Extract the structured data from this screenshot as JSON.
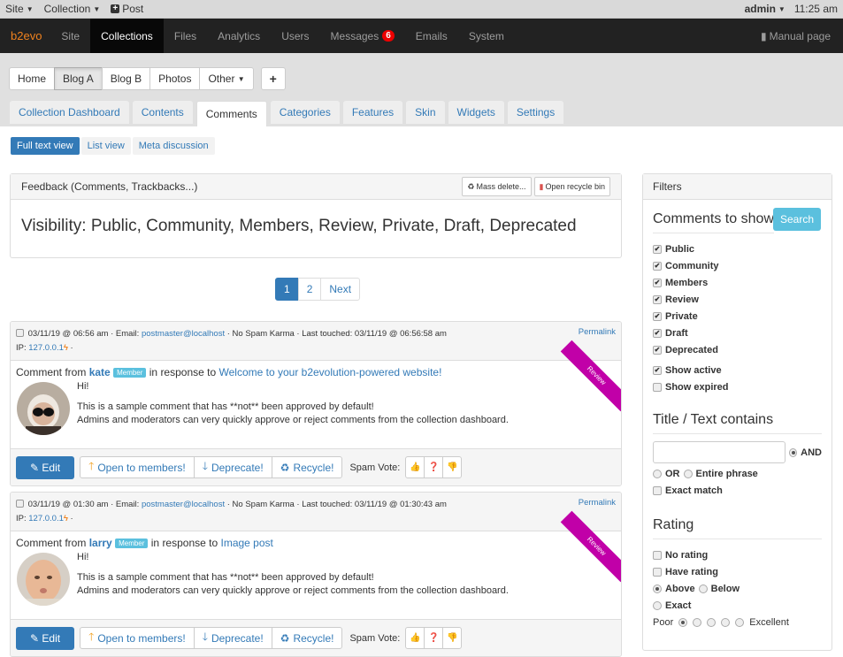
{
  "topbar": {
    "site": "Site",
    "collection": "Collection",
    "post": "Post",
    "user": "admin",
    "time": "11:25 am"
  },
  "nav": {
    "brand": "b2evo",
    "items": [
      "Site",
      "Collections",
      "Files",
      "Analytics",
      "Users",
      "Messages",
      "Emails",
      "System"
    ],
    "active": "Collections",
    "messages_badge": "6",
    "manual": "Manual page"
  },
  "collections": {
    "items": [
      "Home",
      "Blog A",
      "Blog B",
      "Photos",
      "Other"
    ],
    "selected": "Blog A",
    "add": "+"
  },
  "tabs": {
    "items": [
      "Collection Dashboard",
      "Contents",
      "Comments",
      "Categories",
      "Features",
      "Skin",
      "Widgets",
      "Settings"
    ],
    "active": "Comments"
  },
  "views": {
    "items": [
      "Full text view",
      "List view",
      "Meta discussion"
    ],
    "active": "Full text view"
  },
  "feedback": {
    "title": "Feedback (Comments, Trackbacks...)",
    "mass_delete": "Mass delete...",
    "recycle_bin": "Open recycle bin",
    "visibility": "Visibility: Public, Community, Members, Review, Private, Draft, Deprecated"
  },
  "pagination": {
    "pages": [
      "1",
      "2"
    ],
    "current": "1",
    "next": "Next"
  },
  "comments": [
    {
      "date": "03/11/19 @ 06:56 am",
      "email_label": "Email:",
      "email": "postmaster@localhost",
      "karma": "No Spam Karma",
      "touched": "Last touched: 03/11/19 @ 06:56:58 am",
      "ip_label": "IP:",
      "ip": "127.0.0.1",
      "permalink": "Permalink",
      "from_label": "Comment from",
      "author": "kate",
      "badge": "Member",
      "response_label": "in response to",
      "post": "Welcome to your b2evolution-powered website!",
      "status": "Review",
      "text": [
        "Hi!",
        "This is a sample comment that has **not** been approved by default!",
        "Admins and moderators can very quickly approve or reject comments from the collection dashboard."
      ],
      "edit": "Edit",
      "open": "Open to members!",
      "deprecate": "Deprecate!",
      "recycle": "Recycle!",
      "spam_vote": "Spam Vote:"
    },
    {
      "date": "03/11/19 @ 01:30 am",
      "email_label": "Email:",
      "email": "postmaster@localhost",
      "karma": "No Spam Karma",
      "touched": "Last touched: 03/11/19 @ 01:30:43 am",
      "ip_label": "IP:",
      "ip": "127.0.0.1",
      "permalink": "Permalink",
      "from_label": "Comment from",
      "author": "larry",
      "badge": "Member",
      "response_label": "in response to",
      "post": "Image post",
      "status": "Review",
      "text": [
        "Hi!",
        "This is a sample comment that has **not** been approved by default!",
        "Admins and moderators can very quickly approve or reject comments from the collection dashboard."
      ],
      "edit": "Edit",
      "open": "Open to members!",
      "deprecate": "Deprecate!",
      "recycle": "Recycle!",
      "spam_vote": "Spam Vote:"
    }
  ],
  "filters": {
    "title": "Filters",
    "search": "Search",
    "show_heading": "Comments to show",
    "statuses": [
      {
        "label": "Public",
        "checked": true
      },
      {
        "label": "Community",
        "checked": true
      },
      {
        "label": "Members",
        "checked": true
      },
      {
        "label": "Review",
        "checked": true
      },
      {
        "label": "Private",
        "checked": true
      },
      {
        "label": "Draft",
        "checked": true
      },
      {
        "label": "Deprecated",
        "checked": true
      }
    ],
    "show_active": "Show active",
    "show_expired": "Show expired",
    "text_heading": "Title / Text contains",
    "text_value": "",
    "and": "AND",
    "or": "OR",
    "entire": "Entire phrase",
    "exact_match": "Exact match",
    "rating_heading": "Rating",
    "no_rating": "No rating",
    "have_rating": "Have rating",
    "above": "Above",
    "below": "Below",
    "exact": "Exact",
    "poor": "Poor",
    "excellent": "Excellent",
    "rating_selected": 1
  }
}
